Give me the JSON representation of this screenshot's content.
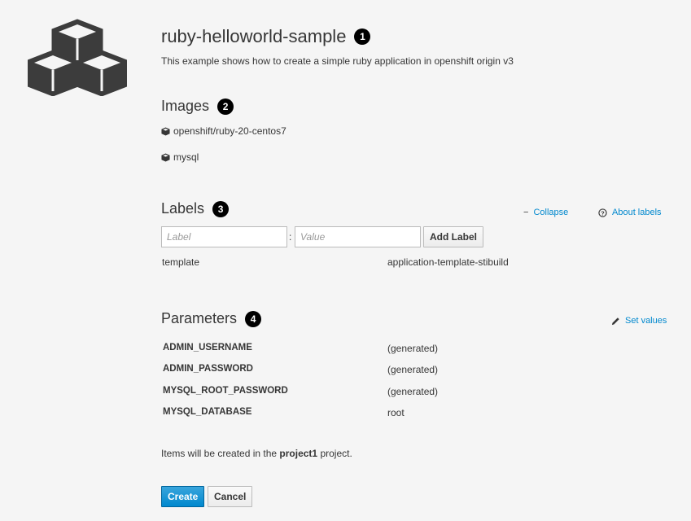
{
  "template": {
    "name": "ruby-helloworld-sample",
    "description": "This example shows how to create a simple ruby application in openshift origin v3"
  },
  "callouts": [
    "1",
    "2",
    "3",
    "4"
  ],
  "images": {
    "title": "Images",
    "items": [
      "openshift/ruby-20-centos7",
      "mysql"
    ]
  },
  "labels": {
    "title": "Labels",
    "collapse_link": "Collapse",
    "about_link": "About labels",
    "label_placeholder": "Label",
    "value_placeholder": "Value",
    "separator": ":",
    "add_button": "Add Label",
    "entries": [
      {
        "key": "template",
        "value": "application-template-stibuild"
      }
    ]
  },
  "parameters": {
    "title": "Parameters",
    "set_values_link": "Set values",
    "items": [
      {
        "name": "ADMIN_USERNAME",
        "value": "(generated)"
      },
      {
        "name": "ADMIN_PASSWORD",
        "value": "(generated)"
      },
      {
        "name": "MYSQL_ROOT_PASSWORD",
        "value": "(generated)"
      },
      {
        "name": "MYSQL_DATABASE",
        "value": "root"
      }
    ]
  },
  "footer": {
    "note_prefix": "Items will be created in the",
    "project": "project1",
    "note_suffix": "project.",
    "create_button": "Create",
    "cancel_button": "Cancel"
  },
  "colors": {
    "primary": "#0088ce",
    "link": "#0088ce",
    "background": "#f5f5f5",
    "logo": "#3c3c3c"
  },
  "icons": [
    "cubes-logo-icon",
    "cube-icon",
    "minus-icon",
    "question-circle-icon",
    "pencil-icon"
  ]
}
